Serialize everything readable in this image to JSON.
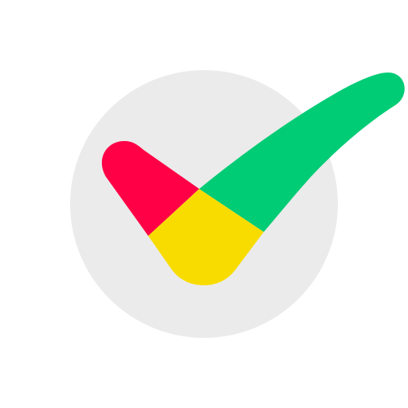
{
  "icon": {
    "name": "checkmark-logo-icon",
    "colors": {
      "background": "#ffffff",
      "circle": "#ebebeb",
      "red": "#ff0046",
      "yellow": "#f8dc00",
      "green": "#00cc76"
    }
  }
}
